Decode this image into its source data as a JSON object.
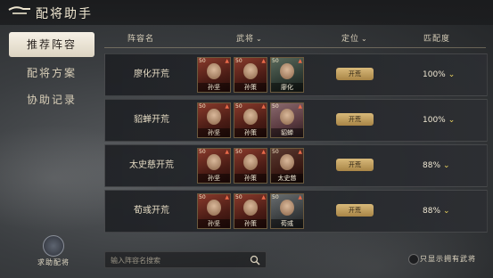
{
  "header": {
    "title": "配将助手"
  },
  "sidebar": {
    "items": [
      {
        "label": "推荐阵容",
        "active": true
      },
      {
        "label": "配将方案",
        "active": false
      },
      {
        "label": "协助记录",
        "active": false
      }
    ],
    "assist_label": "求助配将"
  },
  "table": {
    "columns": {
      "name": "阵容名",
      "generals": "武将",
      "role": "定位",
      "match": "匹配度"
    },
    "rows": [
      {
        "name": "廖化开荒",
        "generals": [
          {
            "name": "孙坚",
            "level": "50"
          },
          {
            "name": "孙策",
            "level": "50"
          },
          {
            "name": "廖化",
            "level": "50"
          }
        ],
        "role": "开荒",
        "match": "100%"
      },
      {
        "name": "貂蝉开荒",
        "generals": [
          {
            "name": "孙坚",
            "level": "50"
          },
          {
            "name": "孙策",
            "level": "50"
          },
          {
            "name": "貂蝉",
            "level": "50"
          }
        ],
        "role": "开荒",
        "match": "100%"
      },
      {
        "name": "太史慈开荒",
        "generals": [
          {
            "name": "孙坚",
            "level": "50"
          },
          {
            "name": "孙策",
            "level": "50"
          },
          {
            "name": "太史慈",
            "level": "50"
          }
        ],
        "role": "开荒",
        "match": "88%"
      },
      {
        "name": "荀彧开荒",
        "generals": [
          {
            "name": "孙坚",
            "level": "50"
          },
          {
            "name": "孙策",
            "level": "50"
          },
          {
            "name": "荀彧",
            "level": "50"
          }
        ],
        "role": "开荒",
        "match": "88%"
      }
    ]
  },
  "search": {
    "placeholder": "输入阵容名搜索"
  },
  "filter": {
    "owned_only_label": "只显示拥有武将"
  }
}
